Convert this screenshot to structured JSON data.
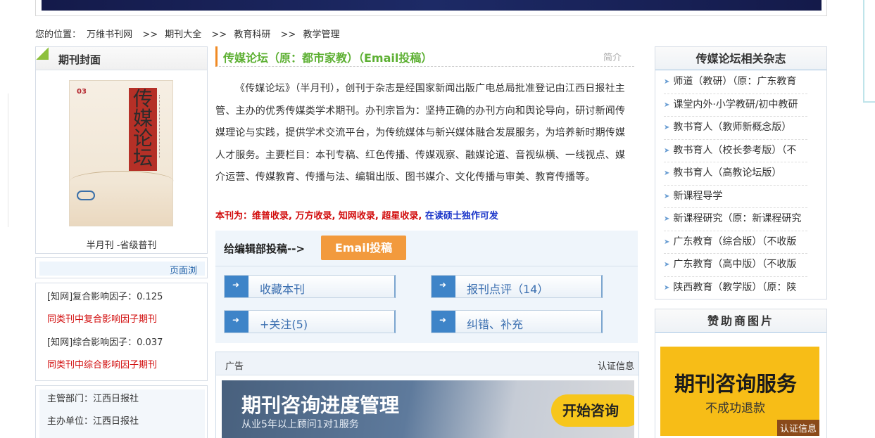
{
  "breadcrumb": {
    "prefix": "您的位置：",
    "items": [
      "万维书刊网",
      "期刊大全",
      "教育科研",
      "教学管理"
    ],
    "sep": ">>"
  },
  "cover": {
    "title": "期刊封面",
    "issue_num": "03",
    "cover_title": "传媒论坛",
    "caption": "半月刊 -省级普刊"
  },
  "browse": {
    "label": "页面浏"
  },
  "factors": {
    "compound_label": "[知网]复合影响因子：0.125",
    "compound_link": "同类刊中复合影响因子期刊",
    "overall_label": "[知网]综合影响因子：0.037",
    "overall_link": "同类刊中综合影响因子期刊"
  },
  "units": {
    "supervisor": "主管部门：江西日报社",
    "sponsor": "主办单位：江西日报社"
  },
  "main": {
    "title": "传媒论坛（原：都市家教）（Email投稿）",
    "intro_link": "简介",
    "description": "《传媒论坛》（半月刊），创刊于杂志是经国家新闻出版广电总局批准登记由江西日报社主管、主办的优秀传媒类学术期刊。办刊宗旨为：坚持正确的办刊方向和舆论导向，研讨新闻传媒理论与实践，提供学术交流平台，为传统媒体与新兴媒体融合发展服务，为培养新时期传媒人才服务。主要栏目：本刊专稿、红色传播、传媒观察、融媒论道、音视纵横、一线视点、媒介运营、传媒教育、传播与法、编辑出版、图书媒介、文化传播与审美、教育传播等。",
    "indexed_prefix": "本刊为：维普收录, 万方收录, 知网收录, 超星收录, ",
    "indexed_blue": "在读硕士独作可发"
  },
  "submit": {
    "label": "给编辑部投稿-->",
    "email_button": "Email投稿",
    "actions": [
      "收藏本刊",
      "报刊点评（14）",
      "+关注(5)",
      "纠错、补充"
    ]
  },
  "ad": {
    "label": "广告",
    "cert": "认证信息",
    "banner_title": "期刊咨询进度管理",
    "banner_sub": "从业5年以上顾问1对1服务",
    "banner_button": "开始咨询"
  },
  "related": {
    "title": "传媒论坛相关杂志",
    "items": [
      "师道（教研）（原：广东教育",
      "课堂内外·小学教研/初中教研",
      "教书育人（教师新概念版）",
      "教书育人（校长参考版）（不",
      "教书育人（高教论坛版）",
      "新课程导学",
      "新课程研究（原：新课程研究",
      "广东教育（综合版）（不收版",
      "广东教育（高中版）（不收版",
      "陕西教育（教学版）（原：陕"
    ]
  },
  "sponsor": {
    "title": "赞助商图片",
    "img_title": "期刊咨询服务",
    "img_sub": "不成功退款",
    "img_badge": "认证信息"
  },
  "colors": {
    "title_green": "#5db033",
    "accent_orange": "#f29a3d",
    "link_blue": "#3b6fb0",
    "alert_red": "#d10a0a"
  }
}
